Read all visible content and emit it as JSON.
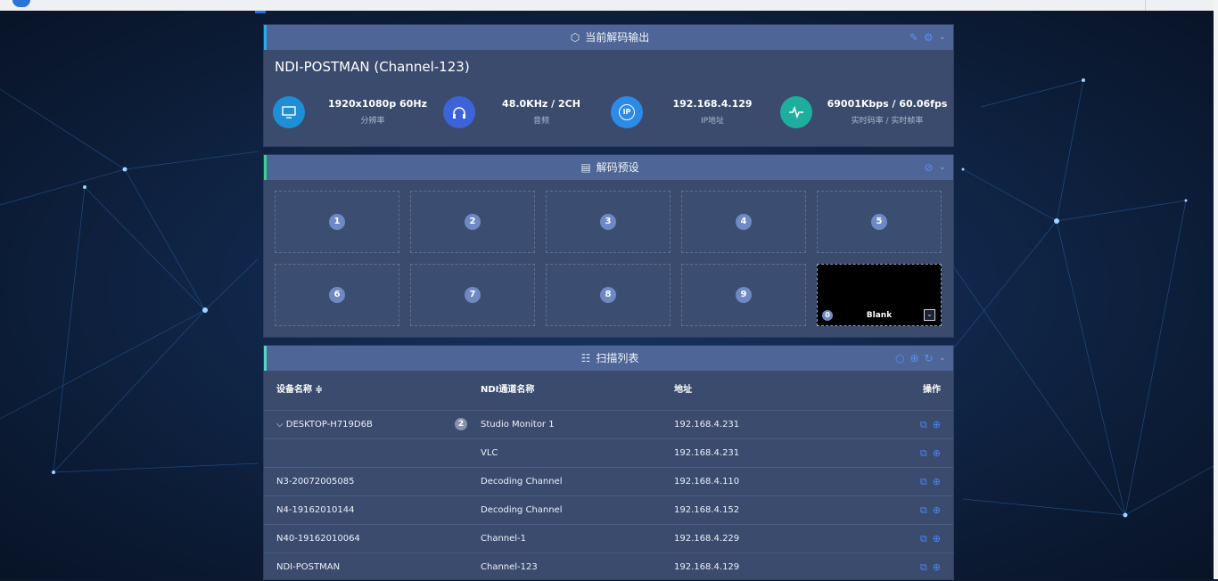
{
  "colors": {
    "accent": "#4f86f2",
    "header": "#4d6597",
    "panel": "#3a4b6e",
    "background": "#0b1830"
  },
  "output": {
    "title": "当前解码输出",
    "title_icon": "cube-icon",
    "device": "NDI-POSTMAN (Channel-123)",
    "stats": [
      {
        "icon": "monitor-icon",
        "value": "1920x1080p 60Hz",
        "label": "分辨率",
        "color": "#1e8ed6"
      },
      {
        "icon": "headphones-icon",
        "value": "48.0KHz / 2CH",
        "label": "音频",
        "color": "#3d63d8"
      },
      {
        "icon": "ip-icon",
        "value": "192.168.4.129",
        "label": "IP地址",
        "color": "#2b8be6"
      },
      {
        "icon": "pulse-icon",
        "value": "69001Kbps / 60.06fps",
        "label": "实时码率 / 实时帧率",
        "color": "#1eae9e"
      }
    ]
  },
  "presets": {
    "title": "解码预设",
    "title_icon": "document-icon",
    "slots": [
      "1",
      "2",
      "3",
      "4",
      "5",
      "6",
      "7",
      "8",
      "9"
    ],
    "blank": {
      "num": "0",
      "label": "Blank"
    }
  },
  "scan": {
    "title": "扫描列表",
    "title_icon": "list-icon",
    "columns": [
      "设备名称 ≑",
      "NDI通道名称",
      "地址",
      "操作"
    ],
    "rows": [
      {
        "device": "⌵ DESKTOP-H719D6B",
        "badge": "2",
        "channel": "Studio Monitor 1",
        "address": "192.168.4.231"
      },
      {
        "device": "",
        "badge": "",
        "channel": "VLC",
        "address": "192.168.4.231"
      },
      {
        "device": "N3-20072005085",
        "badge": "",
        "channel": "Decoding Channel",
        "address": "192.168.4.110"
      },
      {
        "device": "N4-19162010144",
        "badge": "",
        "channel": "Decoding Channel",
        "address": "192.168.4.152"
      },
      {
        "device": "N40-19162010064",
        "badge": "",
        "channel": "Channel-1",
        "address": "192.168.4.229"
      },
      {
        "device": "NDI-POSTMAN",
        "badge": "",
        "channel": "Channel-123",
        "address": "192.168.4.129"
      }
    ]
  }
}
